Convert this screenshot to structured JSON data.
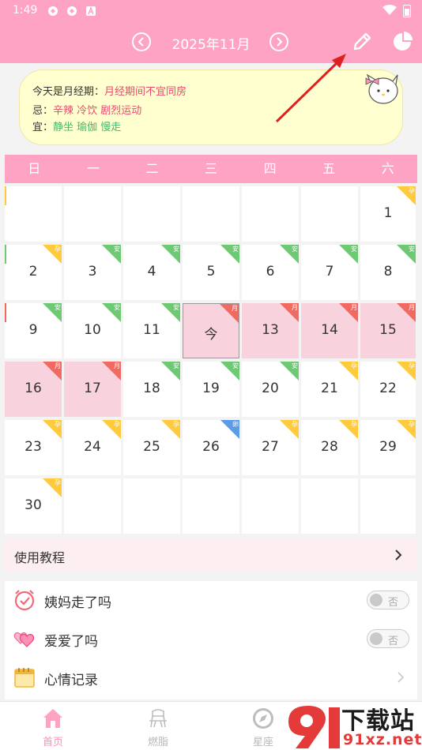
{
  "status": {
    "time": "1:49"
  },
  "header": {
    "title": "2025年11月"
  },
  "tip": {
    "line1_label": "今天是月经期：",
    "line1_value": "月经期间不宜同房",
    "line2_label": "忌：",
    "line2_value": "辛辣 冷饮 剧烈运动",
    "line3_label": "宜：",
    "line3_value": "静坐 瑜伽 慢走"
  },
  "weekdays": [
    "日",
    "一",
    "二",
    "三",
    "四",
    "五",
    "六"
  ],
  "calendar": {
    "weeks": [
      [
        {
          "day": "",
          "tag": "",
          "color": "",
          "left": "yellow"
        },
        {
          "day": "",
          "tag": "",
          "color": ""
        },
        {
          "day": "",
          "tag": "",
          "color": ""
        },
        {
          "day": "",
          "tag": "",
          "color": ""
        },
        {
          "day": "",
          "tag": "",
          "color": ""
        },
        {
          "day": "",
          "tag": "",
          "color": ""
        },
        {
          "day": "1",
          "tag": "孕",
          "color": "yellow"
        }
      ],
      [
        {
          "day": "2",
          "tag": "孕",
          "color": "yellow",
          "left": "green"
        },
        {
          "day": "3",
          "tag": "安",
          "color": "green"
        },
        {
          "day": "4",
          "tag": "安",
          "color": "green"
        },
        {
          "day": "5",
          "tag": "安",
          "color": "green"
        },
        {
          "day": "6",
          "tag": "安",
          "color": "green"
        },
        {
          "day": "7",
          "tag": "安",
          "color": "green"
        },
        {
          "day": "8",
          "tag": "安",
          "color": "green"
        }
      ],
      [
        {
          "day": "9",
          "tag": "安",
          "color": "green",
          "left": "red"
        },
        {
          "day": "10",
          "tag": "安",
          "color": "green"
        },
        {
          "day": "11",
          "tag": "安",
          "color": "green"
        },
        {
          "day": "今",
          "tag": "月",
          "color": "red",
          "state": "today"
        },
        {
          "day": "13",
          "tag": "月",
          "color": "red",
          "state": "period"
        },
        {
          "day": "14",
          "tag": "月",
          "color": "red",
          "state": "period"
        },
        {
          "day": "15",
          "tag": "月",
          "color": "red",
          "state": "period"
        }
      ],
      [
        {
          "day": "16",
          "tag": "月",
          "color": "red",
          "state": "period"
        },
        {
          "day": "17",
          "tag": "月",
          "color": "red",
          "state": "period"
        },
        {
          "day": "18",
          "tag": "安",
          "color": "green"
        },
        {
          "day": "19",
          "tag": "安",
          "color": "green"
        },
        {
          "day": "20",
          "tag": "安",
          "color": "green"
        },
        {
          "day": "21",
          "tag": "孕",
          "color": "yellow"
        },
        {
          "day": "22",
          "tag": "孕",
          "color": "yellow"
        }
      ],
      [
        {
          "day": "23",
          "tag": "孕",
          "color": "yellow"
        },
        {
          "day": "24",
          "tag": "孕",
          "color": "yellow"
        },
        {
          "day": "25",
          "tag": "孕",
          "color": "yellow"
        },
        {
          "day": "26",
          "tag": "卵",
          "color": "blue"
        },
        {
          "day": "27",
          "tag": "孕",
          "color": "yellow"
        },
        {
          "day": "28",
          "tag": "孕",
          "color": "yellow"
        },
        {
          "day": "29",
          "tag": "孕",
          "color": "yellow"
        }
      ],
      [
        {
          "day": "30",
          "tag": "孕",
          "color": "yellow"
        },
        {
          "day": "",
          "tag": "",
          "color": ""
        },
        {
          "day": "",
          "tag": "",
          "color": ""
        },
        {
          "day": "",
          "tag": "",
          "color": ""
        },
        {
          "day": "",
          "tag": "",
          "color": ""
        },
        {
          "day": "",
          "tag": "",
          "color": ""
        },
        {
          "day": "",
          "tag": "",
          "color": ""
        }
      ]
    ]
  },
  "tutorial": {
    "label": "使用教程"
  },
  "list": {
    "period_gone": {
      "label": "姨妈走了吗",
      "toggle": "否"
    },
    "made_love": {
      "label": "爱爱了吗",
      "toggle": "否"
    },
    "mood": {
      "label": "心情记录"
    }
  },
  "tabs": [
    {
      "label": "首页",
      "icon": "home-icon",
      "active": true
    },
    {
      "label": "燃脂",
      "icon": "fat-burn-icon",
      "active": false
    },
    {
      "label": "星座",
      "icon": "compass-icon",
      "active": false
    }
  ],
  "watermark": {
    "brand": "下载站",
    "url": "91xz.net"
  },
  "colors": {
    "accent": "#ffa3c4",
    "period": "#f8d2dc",
    "safe": "#6dca73",
    "fertile": "#ffcb3d",
    "menses": "#f06a62",
    "ovulation": "#5c9ce6"
  }
}
